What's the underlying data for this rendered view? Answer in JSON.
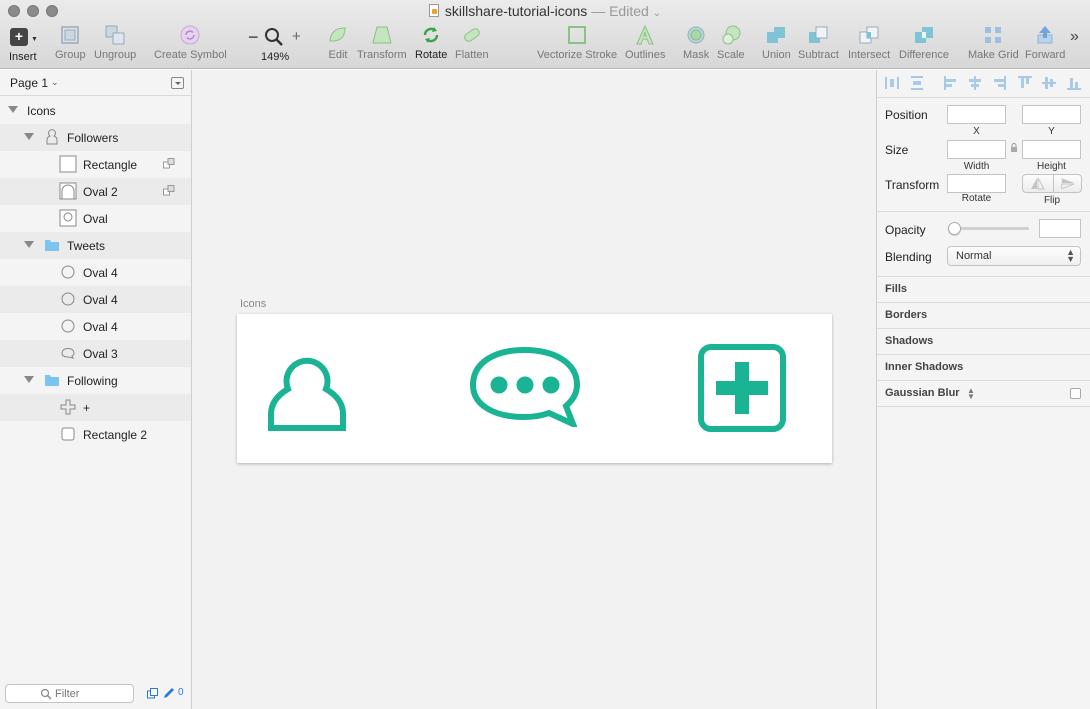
{
  "window": {
    "title": "skillshare-tutorial-icons",
    "status": "— Edited",
    "caret": "⌄"
  },
  "toolbar": {
    "insert": "Insert",
    "group": "Group",
    "ungroup": "Ungroup",
    "create_symbol": "Create Symbol",
    "zoom_minus": "−",
    "zoom_plus": "+",
    "zoom_level": "149%",
    "edit": "Edit",
    "transform": "Transform",
    "rotate": "Rotate",
    "flatten": "Flatten",
    "vectorize_stroke": "Vectorize Stroke",
    "outlines": "Outlines",
    "mask": "Mask",
    "scale": "Scale",
    "union": "Union",
    "subtract": "Subtract",
    "intersect": "Intersect",
    "difference": "Difference",
    "make_grid": "Make Grid",
    "forward": "Forward",
    "more": "»"
  },
  "layers_panel": {
    "page": "Page 1",
    "layers": [
      {
        "name": "Icons",
        "kind": "artboard"
      },
      {
        "name": "Followers",
        "kind": "group"
      },
      {
        "name": "Rectangle",
        "kind": "rectangle"
      },
      {
        "name": "Oval 2",
        "kind": "oval-half"
      },
      {
        "name": "Oval",
        "kind": "oval"
      },
      {
        "name": "Tweets",
        "kind": "folder"
      },
      {
        "name": "Oval 4",
        "kind": "oval"
      },
      {
        "name": "Oval 4",
        "kind": "oval"
      },
      {
        "name": "Oval 4",
        "kind": "oval"
      },
      {
        "name": "Oval 3",
        "kind": "speech-oval"
      },
      {
        "name": "Following",
        "kind": "folder"
      },
      {
        "name": "+",
        "kind": "plus"
      },
      {
        "name": "Rectangle 2",
        "kind": "rectangle"
      }
    ],
    "filter_placeholder": "Filter",
    "filter_count": "0"
  },
  "canvas": {
    "artboard_name": "Icons",
    "icon_color": "#1ab394"
  },
  "inspector": {
    "position": "Position",
    "x": "X",
    "y": "Y",
    "size": "Size",
    "width": "Width",
    "height": "Height",
    "transform": "Transform",
    "rotate": "Rotate",
    "flip": "Flip",
    "opacity": "Opacity",
    "blending": "Blending",
    "blending_value": "Normal",
    "fills": "Fills",
    "borders": "Borders",
    "shadows": "Shadows",
    "inner_shadows": "Inner Shadows",
    "gaussian_blur": "Gaussian Blur"
  }
}
